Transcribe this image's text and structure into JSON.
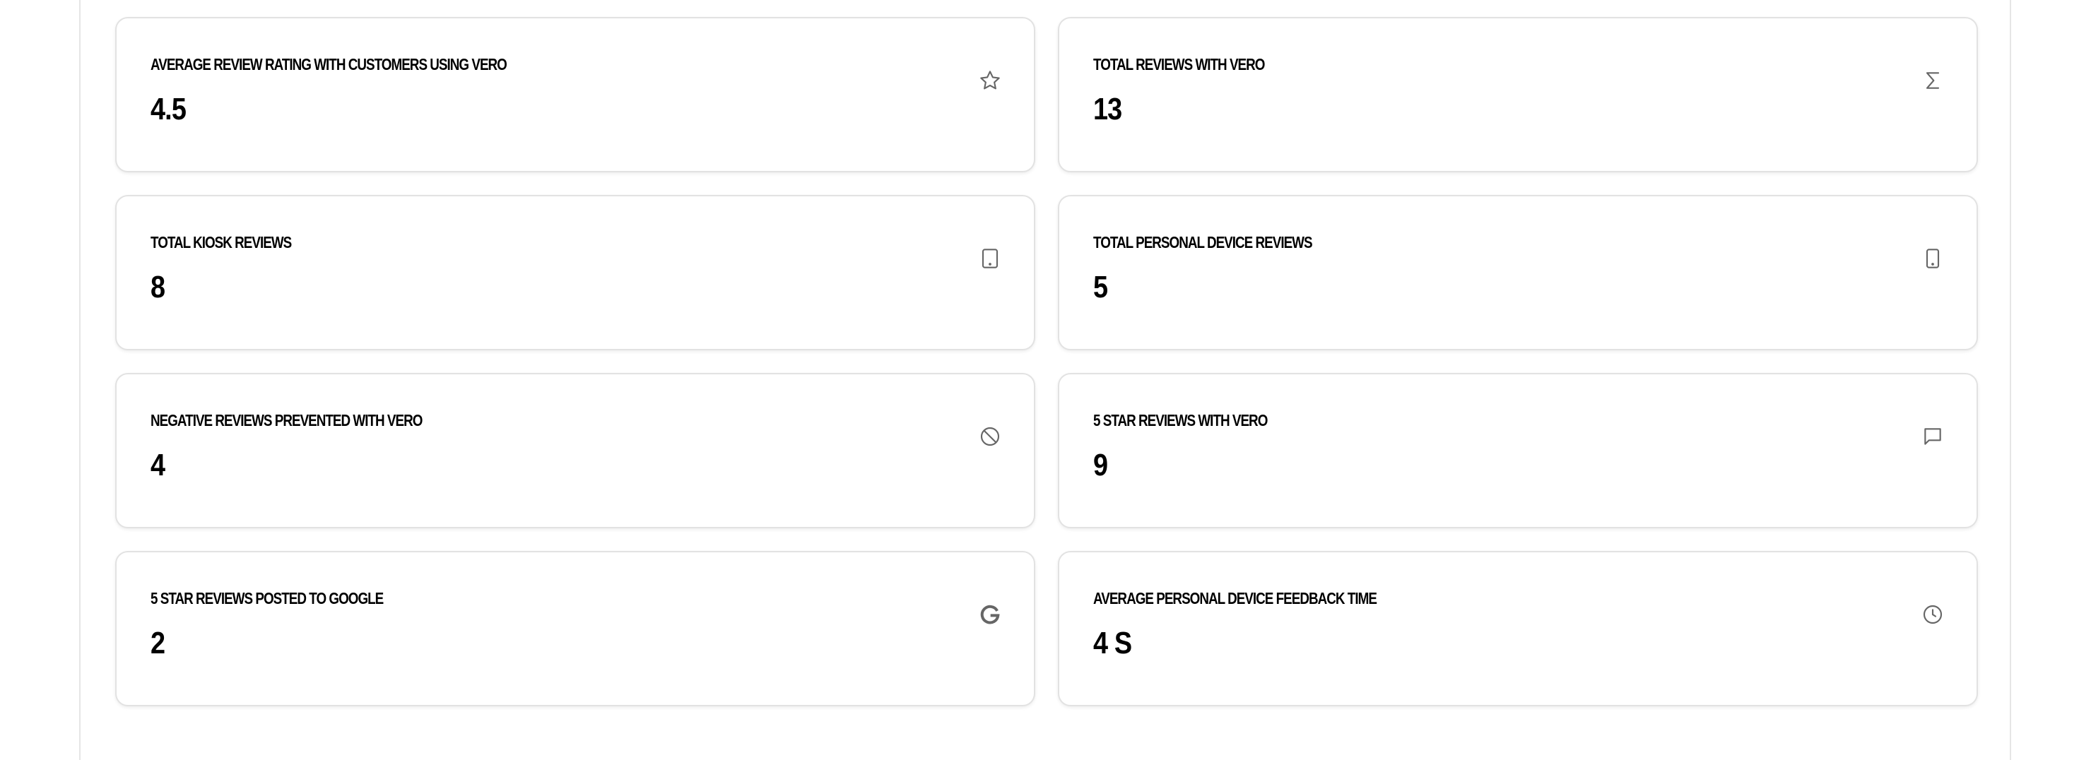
{
  "stats": [
    {
      "label": "AVERAGE REVIEW RATING WITH CUSTOMERS USING VERO",
      "value": "4.5",
      "icon": "star-icon"
    },
    {
      "label": "TOTAL REVIEWS WITH VERO",
      "value": "13",
      "icon": "sigma-icon"
    },
    {
      "label": "TOTAL KIOSK REVIEWS",
      "value": "8",
      "icon": "tablet-icon"
    },
    {
      "label": "TOTAL PERSONAL DEVICE REVIEWS",
      "value": "5",
      "icon": "smartphone-icon"
    },
    {
      "label": "NEGATIVE REVIEWS PREVENTED WITH VERO",
      "value": "4",
      "icon": "ban-icon"
    },
    {
      "label": "5 STAR REVIEWS WITH VERO",
      "value": "9",
      "icon": "message-square-icon"
    },
    {
      "label": "5 STAR REVIEWS POSTED TO GOOGLE",
      "value": "2",
      "icon": "google-icon"
    },
    {
      "label": "AVERAGE PERSONAL DEVICE FEEDBACK TIME",
      "value": "4 S",
      "icon": "clock-icon"
    }
  ],
  "colors": {
    "icon": "#666666",
    "border": "#e2e2e2",
    "text": "#000000"
  }
}
